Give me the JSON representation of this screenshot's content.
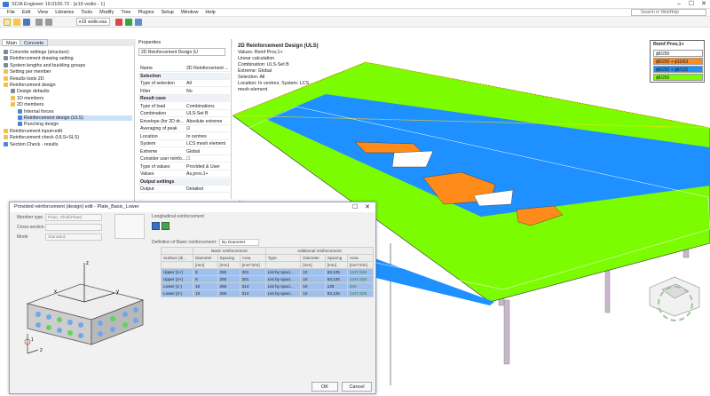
{
  "app": {
    "title": "SCIA Engineer 19.0100.72 - [e19 vedio - 1]",
    "search_placeholder": "Search in WebHelp",
    "project_selector": "e19 vedio.esa"
  },
  "window_buttons": [
    "–",
    "☐",
    "✕"
  ],
  "menu": [
    "File",
    "Edit",
    "View",
    "Libraries",
    "Tools",
    "Modify",
    "Tree",
    "Plugins",
    "Setup",
    "Window",
    "Help"
  ],
  "tabs": {
    "main": "Main",
    "concrete": "Concrete"
  },
  "tree": [
    {
      "label": "Concrete settings (structure)",
      "level": 0,
      "icon": "gear-icon"
    },
    {
      "label": "Reinforcement drawing setting",
      "level": 0,
      "icon": "gear-icon"
    },
    {
      "label": "System lengths and buckling groups",
      "level": 0,
      "icon": "gear-icon"
    },
    {
      "label": "Setting per member",
      "level": 0,
      "icon": "folder-icon"
    },
    {
      "label": "Results tools 2D",
      "level": 0,
      "icon": "folder-icon"
    },
    {
      "label": "Reinforcement design",
      "level": 0,
      "icon": "folder-icon"
    },
    {
      "label": "Design defaults",
      "level": 1,
      "icon": "gear-icon"
    },
    {
      "label": "1D members",
      "level": 1,
      "icon": "folder-icon"
    },
    {
      "label": "2D members",
      "level": 1,
      "icon": "folder-icon"
    },
    {
      "label": "Internal forces",
      "level": 2,
      "icon": "result-icon"
    },
    {
      "label": "Reinforcement design (ULS)",
      "level": 2,
      "icon": "result-icon",
      "selected": true
    },
    {
      "label": "Punching design",
      "level": 2,
      "icon": "result-icon"
    },
    {
      "label": "Reinforcement input+edit",
      "level": 0,
      "icon": "folder-icon"
    },
    {
      "label": "Reinforcement check (ULS+SLS)",
      "level": 0,
      "icon": "folder-icon"
    },
    {
      "label": "Section Check - results",
      "level": 0,
      "icon": "result-icon"
    }
  ],
  "properties": {
    "panel_title": "Properties",
    "selector": "2D Reinforcement Design (U",
    "rows": [
      {
        "k": "Name",
        "v": "2D Reinforcement ..."
      },
      {
        "k": "Selection",
        "v": "",
        "section": true
      },
      {
        "k": "Type of selection",
        "v": "All"
      },
      {
        "k": "Filter",
        "v": "No"
      },
      {
        "k": "Result case",
        "v": "",
        "section": true
      },
      {
        "k": "Type of load",
        "v": "Combinations"
      },
      {
        "k": "Combination",
        "v": "ULS-Set B"
      },
      {
        "k": "Envelope (for 2D dr...",
        "v": "Absolute extreme"
      },
      {
        "k": "Averaging of peak",
        "v": "☑"
      },
      {
        "k": "Location",
        "v": "In centres"
      },
      {
        "k": "System",
        "v": "LCS mesh element"
      },
      {
        "k": "Extreme",
        "v": "Global"
      },
      {
        "k": "Consider user reinfo...",
        "v": "☐"
      },
      {
        "k": "Type of values",
        "v": "Provided & User"
      },
      {
        "k": "Values",
        "v": "As,prov,1+"
      },
      {
        "k": "Output settings",
        "v": "",
        "section": true
      },
      {
        "k": "Output",
        "v": "Detailed"
      }
    ]
  },
  "view_info": {
    "title": "2D Reinforcement Design (ULS)",
    "lines": [
      "Values: Reinf Prov,1+",
      "Linear calculation",
      "Combination: ULS-Set B",
      "Extreme: Global",
      "Selection: All",
      "Location: In centres. System: LCS",
      "mesh element"
    ]
  },
  "legend": {
    "title": "Reinf Prov,1+",
    "items": [
      {
        "label": "ϕ8/250",
        "color": "#ffffff"
      },
      {
        "label": "ϕ8/250 + ϕ10/63",
        "color": "#ff8c1a"
      },
      {
        "label": "ϕ8/250 + ϕ8/125",
        "color": "#1e90ff"
      },
      {
        "label": "ϕ8/250",
        "color": "#7cfc00"
      }
    ]
  },
  "dialog": {
    "title": "Provided reinforcement (design) edit - Plate_Basic_Lower",
    "member_type_label": "Member type",
    "member_type_value": "Plate, Shell(Plate)",
    "cross_section_label": "Cross-section",
    "mode_label": "Mode",
    "mode_value": "Standard",
    "long_reinf_label": "Longitudinal reinforcement",
    "definition_label": "Definition of Basic reinforcement :",
    "definition_value": "By Diameter",
    "group_basic": "Basic reinforcement",
    "group_additional": "Additional reinforcement",
    "columns": [
      "Surface (di...",
      "Diameter",
      "Spacing",
      "Area",
      "Type",
      "Diameter",
      "Spacing",
      "Area"
    ],
    "units": [
      "",
      "[mm]",
      "[mm]",
      "[mm^2/m]",
      "",
      "[mm]",
      "[mm]",
      "[mm^2/m]"
    ],
    "rows": [
      [
        "Upper (1+)",
        "8",
        "250",
        "201",
        "List by spaci...",
        "10",
        "63,125",
        "1247,628"
      ],
      [
        "Upper (2+)",
        "8",
        "250",
        "201",
        "List by spaci...",
        "10",
        "63,125",
        "1247,628"
      ],
      [
        "Lower (1-)",
        "10",
        "250",
        "314",
        "List by spaci...",
        "10",
        "125",
        "628"
      ],
      [
        "Lower (2-)",
        "10",
        "250",
        "314",
        "List by spaci...",
        "10",
        "63,125",
        "1247,628"
      ]
    ],
    "axis_labels": [
      "z",
      "y",
      "x",
      "1",
      "2"
    ],
    "ok_label": "OK",
    "cancel_label": "Cancel"
  },
  "colors": {
    "green": "#7cfc00",
    "blue": "#1e90ff",
    "orange": "#ff8c1a"
  }
}
